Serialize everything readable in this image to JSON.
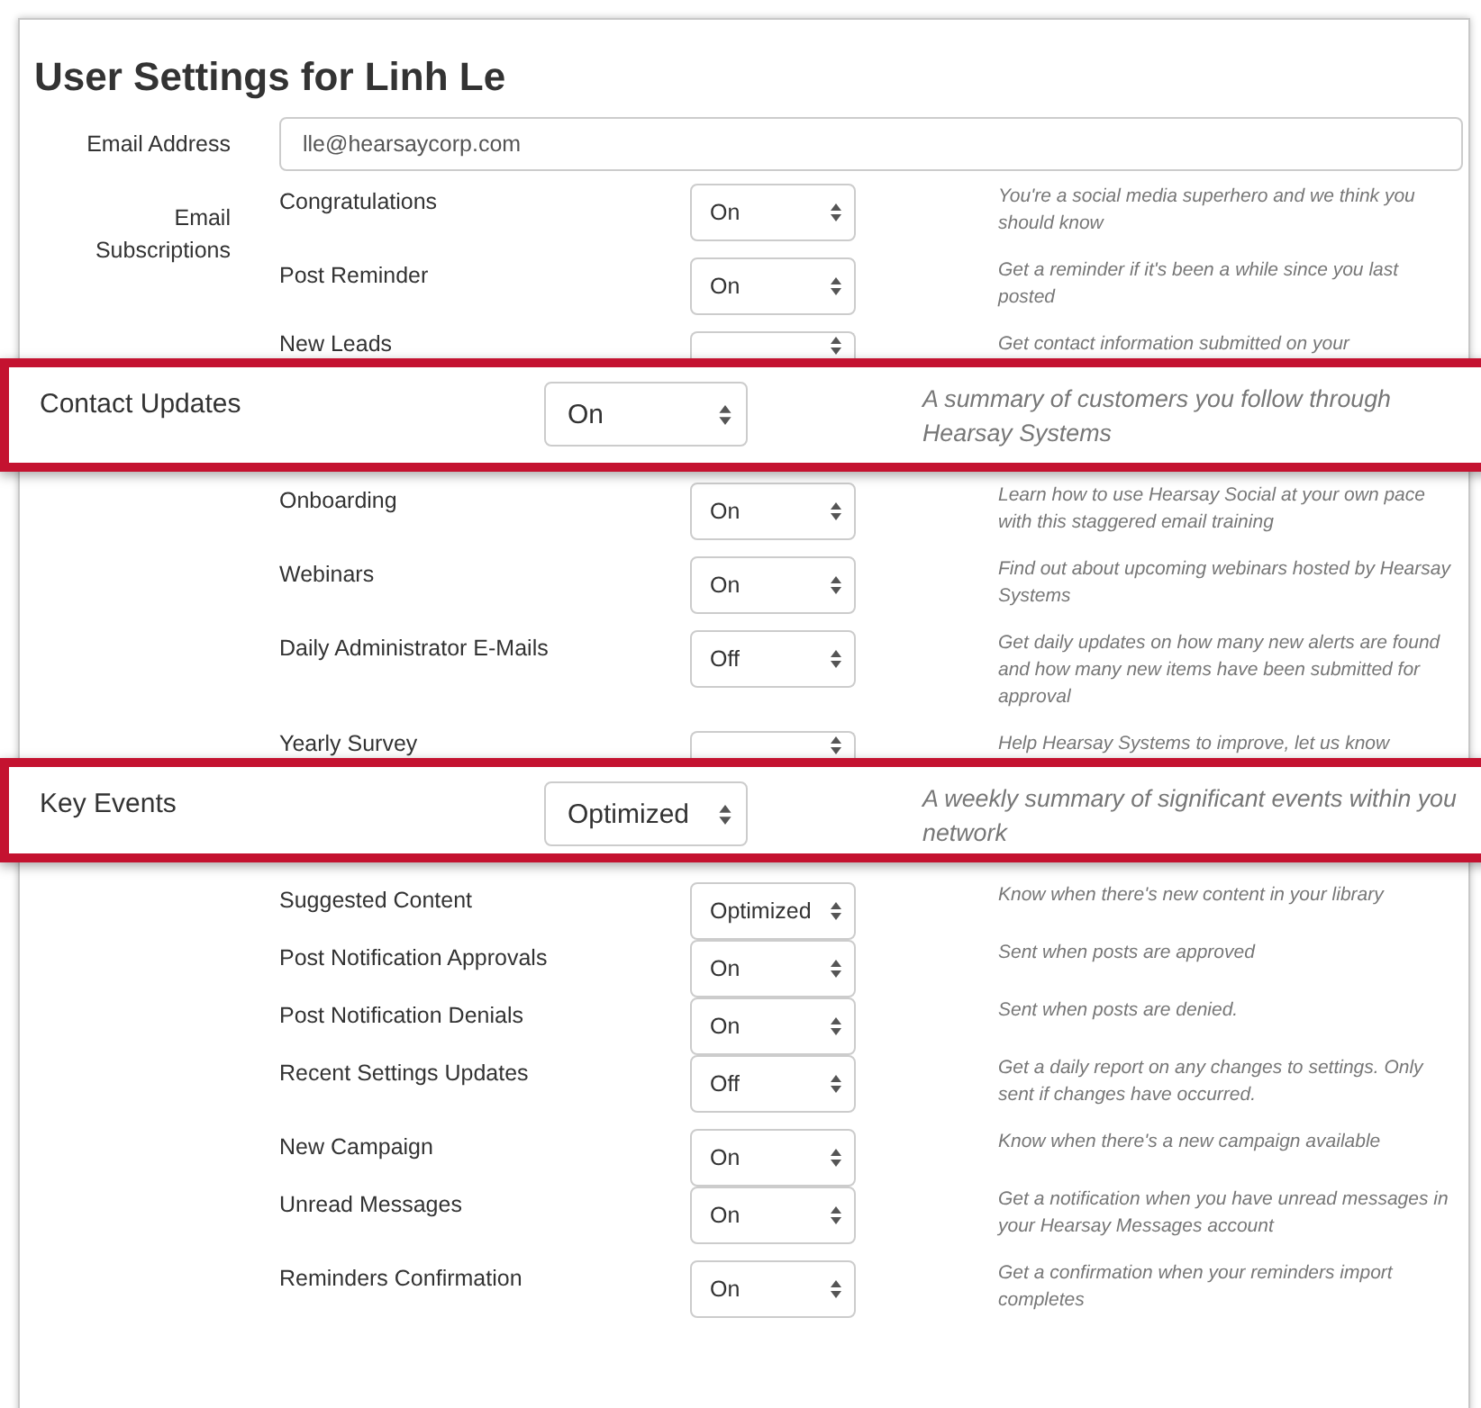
{
  "title": "User Settings for Linh Le",
  "email": {
    "label": "Email Address",
    "value": "lle@hearsaycorp.com"
  },
  "subscriptions_label": "Email Subscriptions",
  "subscriptions": [
    {
      "kind": "row",
      "name": "Congratulations",
      "value": "On",
      "description": "You're a social media superhero and we think you should know"
    },
    {
      "kind": "row",
      "name": "Post Reminder",
      "value": "On",
      "description": "Get a reminder if it's been a while since you last posted"
    },
    {
      "kind": "cut",
      "name": "New Leads",
      "description": "Get contact information submitted on your"
    },
    {
      "kind": "highlight",
      "name": "Contact Updates",
      "value": "On",
      "description": "A summary of customers you follow through Hearsay Systems"
    },
    {
      "kind": "row",
      "name": "Onboarding",
      "value": "On",
      "description": "Learn how to use Hearsay Social at your own pace with this staggered email training"
    },
    {
      "kind": "row",
      "name": "Webinars",
      "value": "On",
      "description": "Find out about upcoming webinars hosted by Hearsay Systems"
    },
    {
      "kind": "row",
      "name": "Daily Administrator E-Mails",
      "value": "Off",
      "description": "Get daily updates on how many new alerts are found and how many new items have been submitted for approval"
    },
    {
      "kind": "cut",
      "name": "Yearly Survey",
      "description": "Help Hearsay Systems to improve, let us know"
    },
    {
      "kind": "highlight",
      "name": "Key Events",
      "value": "Optimized",
      "description": "A weekly summary of significant events within you network"
    },
    {
      "kind": "row",
      "name": "Suggested Content",
      "value": "Optimized",
      "description": "Know when there's new content in your library"
    },
    {
      "kind": "row",
      "name": "Post Notification Approvals",
      "value": "On",
      "description": "Sent when posts are approved"
    },
    {
      "kind": "row",
      "name": "Post Notification Denials",
      "value": "On",
      "description": "Sent when posts are denied."
    },
    {
      "kind": "row",
      "name": "Recent Settings Updates",
      "value": "Off",
      "description": "Get a daily report on any changes to settings. Only sent if changes have occurred."
    },
    {
      "kind": "row",
      "name": "New Campaign",
      "value": "On",
      "description": "Know when there's a new campaign available"
    },
    {
      "kind": "row",
      "name": "Unread Messages",
      "value": "On",
      "description": "Get a notification when you have unread messages in your Hearsay Messages account"
    },
    {
      "kind": "row",
      "name": "Reminders Confirmation",
      "value": "On",
      "description": "Get a confirmation when your reminders import completes"
    }
  ]
}
